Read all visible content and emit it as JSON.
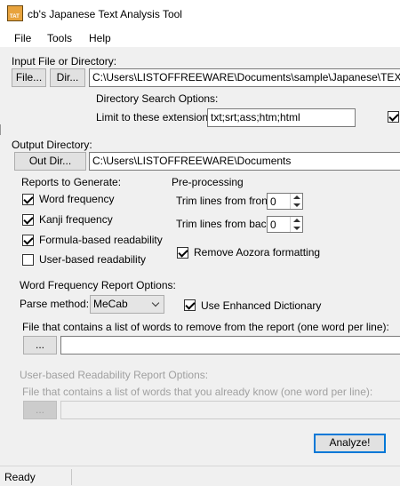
{
  "window": {
    "title": "cb's Japanese Text Analysis Tool",
    "icon_label": "TAT"
  },
  "menu": {
    "file": "File",
    "tools": "Tools",
    "help": "Help"
  },
  "input": {
    "section_label": "Input File or Directory:",
    "file_button": "File...",
    "dir_button": "Dir...",
    "path_value": "C:\\Users\\LISTOFFREEWARE\\Documents\\sample\\Japanese\\TEXT\\K-ai",
    "dir_search_label": "Directory Search Options:",
    "limit_label": "Limit to these extensions:",
    "extensions_value": "txt;srt;ass;htm;html",
    "limit_checked": true
  },
  "output": {
    "section_label": "Output Directory:",
    "out_dir_button": "Out Dir...",
    "path_value": "C:\\Users\\LISTOFFREEWARE\\Documents"
  },
  "reports": {
    "section_label": "Reports to Generate:",
    "word_frequency": {
      "label": "Word frequency",
      "checked": true
    },
    "kanji_frequency": {
      "label": "Kanji frequency",
      "checked": true
    },
    "formula_readability": {
      "label": "Formula-based readability",
      "checked": true
    },
    "user_readability": {
      "label": "User-based readability",
      "checked": false
    }
  },
  "preprocessing": {
    "section_label": "Pre-processing",
    "trim_front_label": "Trim lines from front:",
    "trim_front_value": "0",
    "trim_back_label": "Trim lines from back:",
    "trim_back_value": "0",
    "remove_aozora": {
      "label": "Remove Aozora formatting",
      "checked": true
    }
  },
  "word_freq_options": {
    "section_label": "Word Frequency Report Options:",
    "parse_method_label": "Parse method:",
    "parse_method_value": "MeCab",
    "enhanced_dictionary": {
      "label": "Use Enhanced Dictionary",
      "checked": true
    },
    "remove_words_label": "File that contains a list of words to remove from the report (one word per line):",
    "browse_button": "...",
    "remove_words_value": ""
  },
  "user_readability_options": {
    "section_label": "User-based Readability Report Options:",
    "known_words_label": "File that contains a list of words that you already know (one word per line):",
    "browse_button": "...",
    "known_words_value": ""
  },
  "actions": {
    "analyze_button": "Analyze!"
  },
  "status": {
    "text": "Ready"
  }
}
